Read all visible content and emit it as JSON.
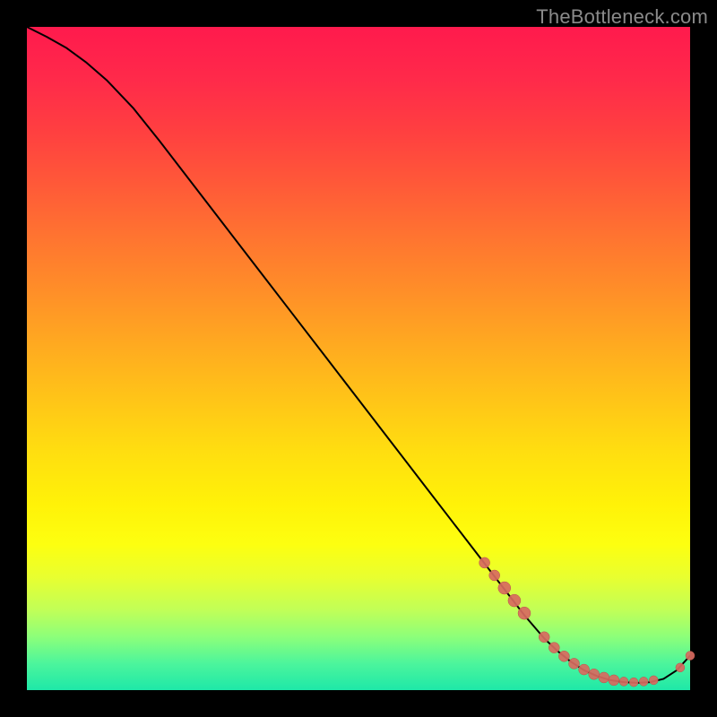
{
  "watermark": "TheBottleneck.com",
  "colors": {
    "curve": "#000000",
    "point_fill": "#d86a5f",
    "point_stroke": "#b9534a"
  },
  "chart_data": {
    "type": "line",
    "title": "",
    "xlabel": "",
    "ylabel": "",
    "xlim": [
      0,
      100
    ],
    "ylim": [
      0,
      100
    ],
    "grid": false,
    "legend": false,
    "series": [
      {
        "name": "bottleneck-curve",
        "x": [
          0,
          3,
          6,
          9,
          12,
          16,
          20,
          25,
          30,
          35,
          40,
          45,
          50,
          55,
          60,
          64,
          68,
          72,
          75,
          78,
          80,
          82,
          84,
          86,
          88,
          90,
          92,
          94,
          96,
          98,
          100
        ],
        "y": [
          100,
          98.5,
          96.8,
          94.6,
          92.0,
          87.8,
          82.8,
          76.3,
          69.8,
          63.3,
          56.8,
          50.3,
          43.8,
          37.3,
          30.8,
          25.6,
          20.4,
          15.2,
          11.3,
          7.8,
          5.9,
          4.3,
          3.0,
          2.1,
          1.5,
          1.2,
          1.1,
          1.2,
          1.7,
          3.0,
          5.2
        ]
      }
    ],
    "highlight_points": {
      "name": "data-markers",
      "points": [
        {
          "x": 69.0,
          "y": 19.2,
          "r": 6
        },
        {
          "x": 70.5,
          "y": 17.3,
          "r": 6
        },
        {
          "x": 72.0,
          "y": 15.4,
          "r": 7
        },
        {
          "x": 73.5,
          "y": 13.5,
          "r": 7
        },
        {
          "x": 75.0,
          "y": 11.6,
          "r": 7
        },
        {
          "x": 78.0,
          "y": 8.0,
          "r": 6
        },
        {
          "x": 79.5,
          "y": 6.4,
          "r": 6
        },
        {
          "x": 81.0,
          "y": 5.1,
          "r": 6
        },
        {
          "x": 82.5,
          "y": 4.0,
          "r": 6
        },
        {
          "x": 84.0,
          "y": 3.1,
          "r": 6
        },
        {
          "x": 85.5,
          "y": 2.4,
          "r": 6
        },
        {
          "x": 87.0,
          "y": 1.9,
          "r": 6
        },
        {
          "x": 88.5,
          "y": 1.5,
          "r": 6
        },
        {
          "x": 90.0,
          "y": 1.3,
          "r": 5
        },
        {
          "x": 91.5,
          "y": 1.2,
          "r": 5
        },
        {
          "x": 93.0,
          "y": 1.3,
          "r": 5
        },
        {
          "x": 94.5,
          "y": 1.5,
          "r": 5
        },
        {
          "x": 98.5,
          "y": 3.4,
          "r": 5
        },
        {
          "x": 100.0,
          "y": 5.2,
          "r": 5
        }
      ]
    }
  }
}
